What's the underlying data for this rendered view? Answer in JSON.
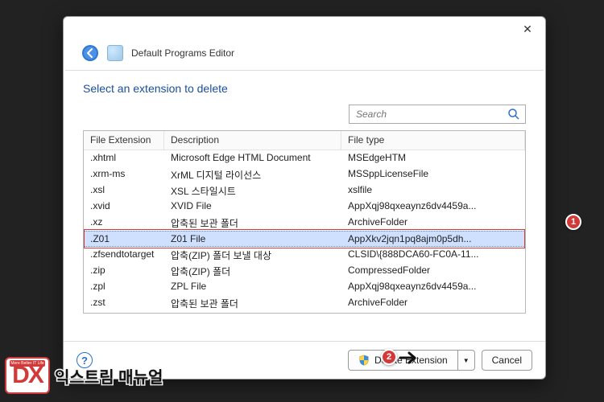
{
  "app_title": "Default Programs Editor",
  "heading": "Select an extension to delete",
  "search": {
    "placeholder": "Search"
  },
  "columns": {
    "ext": "File Extension",
    "desc": "Description",
    "type": "File type"
  },
  "rows": [
    {
      "ext": ".xhtml",
      "desc": "Microsoft Edge HTML Document",
      "type": "MSEdgeHTM"
    },
    {
      "ext": ".xrm-ms",
      "desc": "XrML 디지털 라이선스",
      "type": "MSSppLicenseFile"
    },
    {
      "ext": ".xsl",
      "desc": "XSL 스타일시트",
      "type": "xslfile"
    },
    {
      "ext": ".xvid",
      "desc": "XVID File",
      "type": "AppXqj98qxeaynz6dv4459a..."
    },
    {
      "ext": ".xz",
      "desc": "압축된 보관 폴더",
      "type": "ArchiveFolder"
    },
    {
      "ext": ".Z01",
      "desc": "Z01 File",
      "type": "AppXkv2jqn1pq8ajm0p5dh..."
    },
    {
      "ext": ".zfsendtotarget",
      "desc": "압축(ZIP) 폴더 보낼 대상",
      "type": "CLSID\\{888DCA60-FC0A-11..."
    },
    {
      "ext": ".zip",
      "desc": "압축(ZIP) 폴더",
      "type": "CompressedFolder"
    },
    {
      "ext": ".zpl",
      "desc": "ZPL File",
      "type": "AppXqj98qxeaynz6dv4459a..."
    },
    {
      "ext": ".zst",
      "desc": "압축된 보관 폴더",
      "type": "ArchiveFolder"
    }
  ],
  "selected_index": 5,
  "buttons": {
    "delete": "Delete Extension",
    "cancel": "Cancel"
  },
  "icons": {
    "close": "✕",
    "help": "?",
    "drop": "▼"
  },
  "annotations": {
    "badge1": "1",
    "badge2": "2"
  },
  "brand": {
    "tagline": "More Better IT Life",
    "logo_text": "DX",
    "name": "익스트림 매뉴얼"
  }
}
